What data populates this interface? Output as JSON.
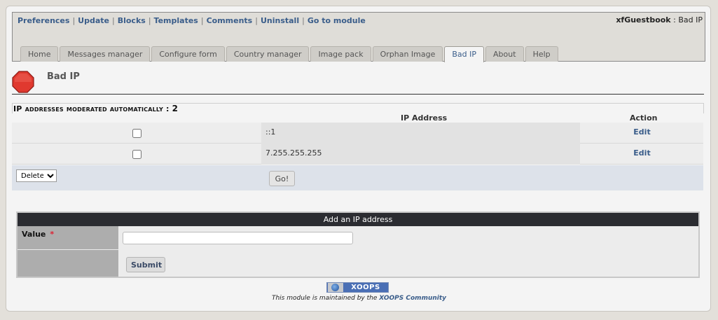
{
  "toplinks": [
    "Preferences",
    "Update",
    "Blocks",
    "Templates",
    "Comments",
    "Uninstall",
    "Go to module"
  ],
  "module": {
    "name": "xfGuestbook",
    "separator": ":",
    "section": "Bad IP"
  },
  "tabs": [
    "Home",
    "Messages manager",
    "Configure form",
    "Country manager",
    "Image pack",
    "Orphan Image",
    "Bad IP",
    "About",
    "Help"
  ],
  "active_tab": "Bad IP",
  "page": {
    "title": "Bad IP"
  },
  "ip_list": {
    "heading": "IP addresses moderated automatically :",
    "count": "2",
    "col_ip": "IP Address",
    "col_action": "Action",
    "rows": [
      {
        "ip": "::1",
        "action": "Edit"
      },
      {
        "ip": "7.255.255.255",
        "action": "Edit"
      }
    ],
    "bulk_action": "Delete",
    "go_label": "Go!"
  },
  "add_form": {
    "title": "Add an IP address",
    "value_label": "Value",
    "required_mark": "*",
    "value": "",
    "submit_label": "Submit"
  },
  "footer": {
    "badge": "XOOPS",
    "text_prefix": "This module is maintained by the ",
    "link": "XOOPS Community"
  },
  "colors": {
    "link": "#3a5d8a",
    "stop_icon": "#e0392f",
    "form_header": "#2b2c31",
    "required": "#dd2233"
  }
}
